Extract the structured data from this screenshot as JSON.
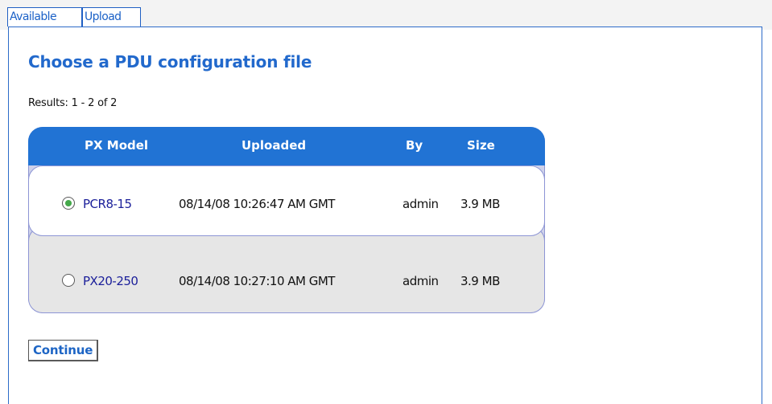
{
  "tabs": [
    {
      "label": "Available"
    },
    {
      "label": "Upload"
    }
  ],
  "page_title": "Choose a PDU configuration file",
  "results_text": "Results: 1 - 2 of 2",
  "table": {
    "headers": [
      "PX Model",
      "Uploaded",
      "By",
      "Size"
    ],
    "rows": [
      {
        "model": "PCR8-15",
        "uploaded": "08/14/08 10:26:47 AM GMT",
        "by": "admin",
        "size": "3.9 MB",
        "selected": true
      },
      {
        "model": "PX20-250",
        "uploaded": "08/14/08 10:27:10 AM GMT",
        "by": "admin",
        "size": "3.9 MB",
        "selected": false
      }
    ]
  },
  "continue_label": "Continue",
  "colors": {
    "accent": "#2173d4",
    "link": "#1b1f9a",
    "tab_border": "#1f5fc3",
    "selected_radio": "#44a84a"
  }
}
